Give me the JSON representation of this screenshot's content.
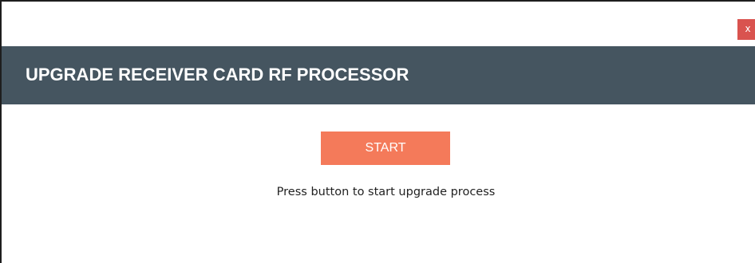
{
  "window": {
    "close_label": "x"
  },
  "header": {
    "title": "UPGRADE RECEIVER CARD RF PROCESSOR"
  },
  "main": {
    "start_label": "START",
    "hint_text": "Press button to start upgrade process"
  },
  "colors": {
    "header_bg": "#455560",
    "accent": "#f47a5a",
    "close_bg": "#d9534f"
  }
}
